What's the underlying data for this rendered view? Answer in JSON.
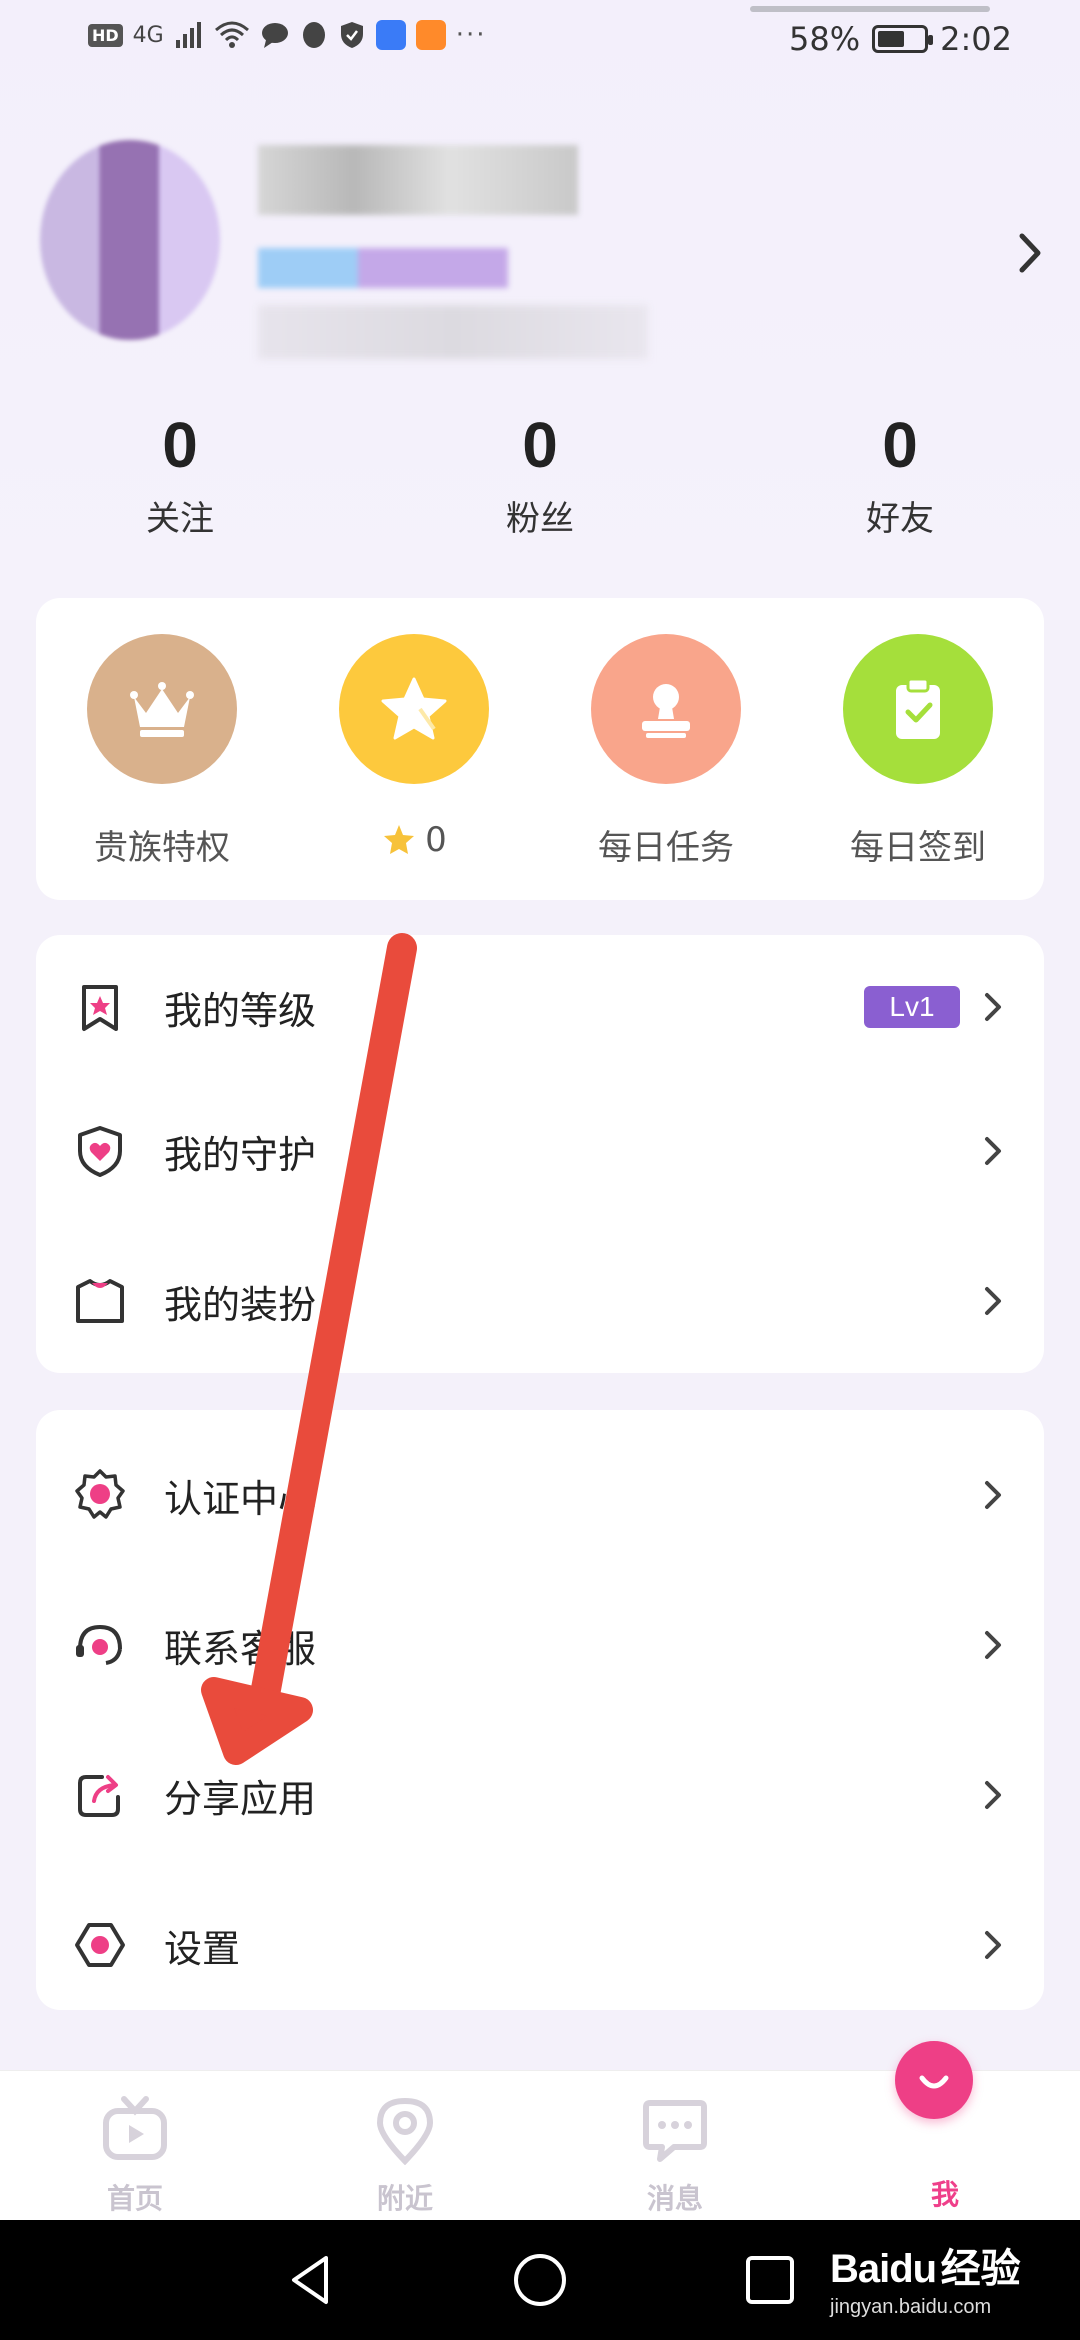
{
  "status_bar": {
    "hd": "HD",
    "network": "4G",
    "dots": "···",
    "battery": "58%",
    "battery_level": 0.58,
    "time": "2:02"
  },
  "stats": [
    {
      "value": "0",
      "label": "关注"
    },
    {
      "value": "0",
      "label": "粉丝"
    },
    {
      "value": "0",
      "label": "好友"
    }
  ],
  "quick_actions": [
    {
      "label": "贵族特权",
      "color": "#d9b18c",
      "icon": "crown-icon"
    },
    {
      "label": "0",
      "color": "#fdc93d",
      "icon": "star-icon"
    },
    {
      "label": "每日任务",
      "color": "#f9a58b",
      "icon": "stamp-icon"
    },
    {
      "label": "每日签到",
      "color": "#a5df3b",
      "icon": "clipboard-check-icon"
    }
  ],
  "menu_group_1": [
    {
      "label": "我的等级",
      "icon": "level-badge-icon",
      "badge": "Lv1"
    },
    {
      "label": "我的守护",
      "icon": "shield-heart-icon"
    },
    {
      "label": "我的装扮",
      "icon": "shirt-icon"
    }
  ],
  "menu_group_2": [
    {
      "label": "认证中心",
      "icon": "certify-icon"
    },
    {
      "label": "联系客服",
      "icon": "headset-icon"
    },
    {
      "label": "分享应用",
      "icon": "share-icon"
    },
    {
      "label": "设置",
      "icon": "settings-icon"
    }
  ],
  "bottom_nav": [
    {
      "label": "首页",
      "icon": "tv-icon",
      "active": false
    },
    {
      "label": "附近",
      "icon": "location-icon",
      "active": false
    },
    {
      "label": "消息",
      "icon": "message-icon",
      "active": false
    },
    {
      "label": "我",
      "icon": "smile-icon",
      "active": true
    }
  ],
  "watermark": {
    "logo": "Bai",
    "paw": "du",
    "cn": "经验",
    "url": "jingyan.baidu.com"
  },
  "colors": {
    "accent_pink": "#ee3f86",
    "level_purple": "#8a5fd1",
    "arrow_red": "#e94b3c"
  }
}
